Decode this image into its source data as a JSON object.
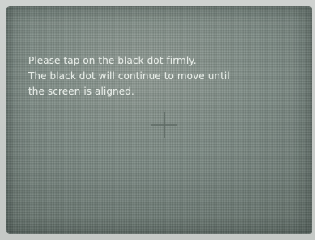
{
  "calibration": {
    "lines": [
      "Please tap on the black dot firmly.",
      "The black dot will continue to move until",
      "the screen is aligned."
    ],
    "target_icon": "crosshair-icon"
  },
  "colors": {
    "screen": "#7c8a84",
    "text": "#eef3ee",
    "crosshair": "#5e6a64"
  }
}
